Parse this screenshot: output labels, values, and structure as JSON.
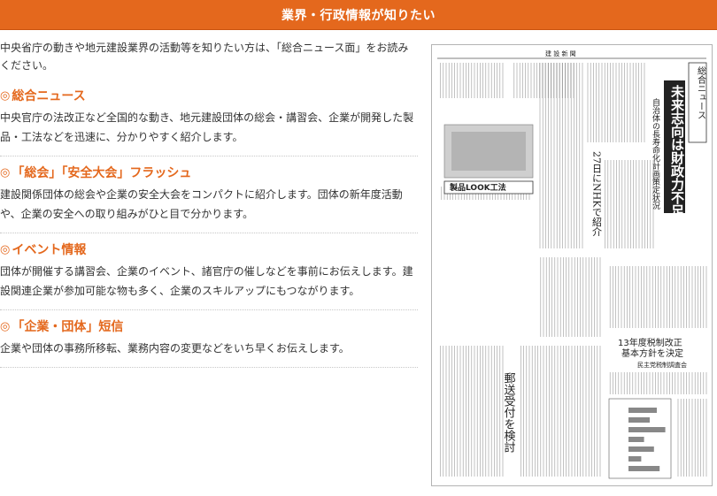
{
  "banner": {
    "title": "業界・行政情報が知りたい"
  },
  "intro": "中央省庁の動きや地元建設業界の活動等を知りたい方は、「総合ニュース面」をお読みください。",
  "sections": [
    {
      "bullet": "◎",
      "title": "総合ニュース",
      "text": "中央官庁の法改正など全国的な動き、地元建設団体の総会・講習会、企業が開発した製品・工法などを迅速に、分かりやすく紹介します。"
    },
    {
      "bullet": "◎",
      "title": "「総会」「安全大会」フラッシュ",
      "text": "建設関係団体の総会や企業の安全大会をコンパクトに紹介します。団体の新年度活動や、企業の安全への取り組みがひと目で分かります。"
    },
    {
      "bullet": "◎",
      "title": "イベント情報",
      "text": "団体が開催する講習会、企業のイベント、諸官庁の催しなどを事前にお伝えします。建設関連企業が参加可能な物も多く、企業のスキルアップにもつながります。"
    },
    {
      "bullet": "◎",
      "title": "「企業・団体」短信",
      "text": "企業や団体の事務所移転、業務内容の変更などをいち早くお伝えします。"
    }
  ],
  "newspaper": {
    "masthead": "建 設 新 聞",
    "section_label": "総合ニュース",
    "headline_main": "未来志向は財政力不足",
    "headline_sub": "自治体の長寿命化計画策定状況",
    "headline_nhk": "27日にNHKで紹介",
    "look_label": "製品LOOK工法",
    "tax_line1": "13年度税制改正",
    "tax_line2": "基本方針を決定",
    "tax_line3": "民主党税制調査会",
    "bottom_headline": "郵送受付を検討",
    "colors": {
      "accent": "#e4681d",
      "ink": "#222222",
      "paper_bg": "#ffffff"
    }
  }
}
